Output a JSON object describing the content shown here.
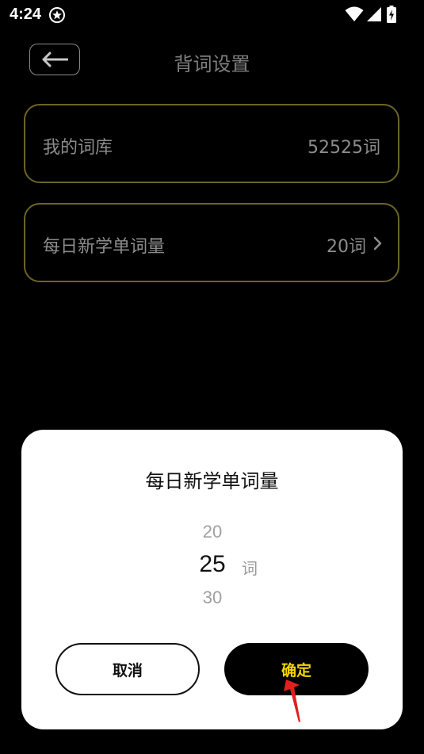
{
  "status_bar": {
    "time": "4:24"
  },
  "header": {
    "title": "背词设置"
  },
  "settings": [
    {
      "label": "我的词库",
      "value": "52525词"
    },
    {
      "label": "每日新学单词量",
      "value": "20词"
    }
  ],
  "dialog": {
    "title": "每日新学单词量",
    "picker": {
      "prev": "20",
      "current": "25",
      "next": "30",
      "unit": "词"
    },
    "cancel_label": "取消",
    "confirm_label": "确定"
  },
  "colors": {
    "background": "#000000",
    "card_border": "#6c6427",
    "confirm_text": "#f2d600",
    "annotation_arrow": "#e0201f"
  },
  "icons": {
    "back": "arrow-left-icon",
    "chevron": "chevron-right-icon",
    "wifi": "wifi-icon",
    "signal": "signal-icon",
    "battery": "battery-charging-icon"
  }
}
